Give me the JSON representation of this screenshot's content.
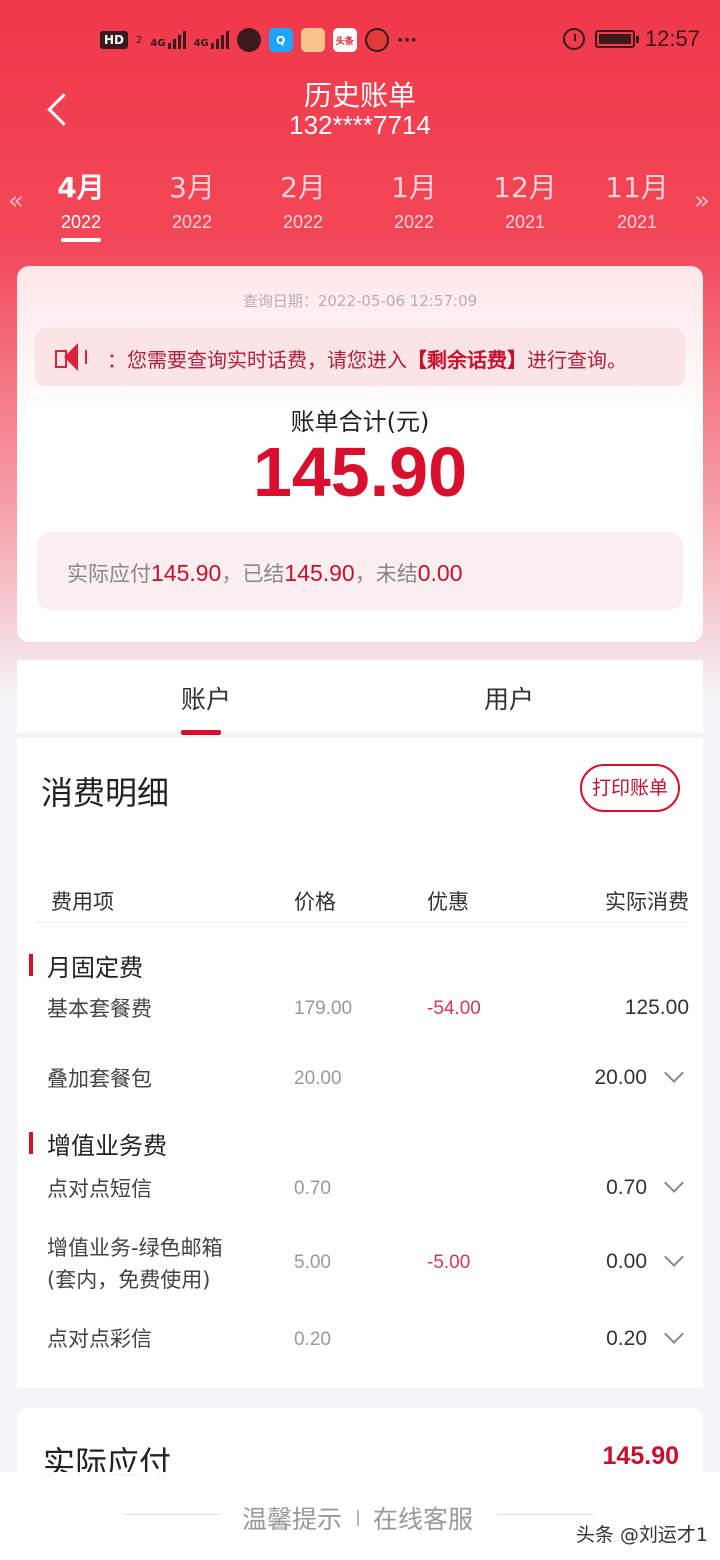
{
  "status_bar": {
    "hd": "HD",
    "sim": "2",
    "signal1": "4G",
    "signal2": "4G",
    "app_icon_3": "头条",
    "more": "···",
    "time": "12:57"
  },
  "header": {
    "title": "历史账单",
    "phone": "132****7714"
  },
  "months": [
    {
      "month": "4月",
      "year": "2022"
    },
    {
      "month": "3月",
      "year": "2022"
    },
    {
      "month": "2月",
      "year": "2022"
    },
    {
      "month": "1月",
      "year": "2022"
    },
    {
      "month": "12月",
      "year": "2021"
    },
    {
      "month": "11月",
      "year": "2021"
    }
  ],
  "nav": {
    "prev": "«",
    "next": "»"
  },
  "summary": {
    "query_date": "查询日期：2022-05-06 12:57:09",
    "notice_pre": "：您需要查询实时话费，请您进入",
    "notice_link": "【剩余话费】",
    "notice_post": "进行查询。",
    "total_label": "账单合计(元)",
    "total_amount": "145.90",
    "due_label": "实际应付",
    "due_value": "145.90",
    "settled_label": "，已结",
    "settled_value": "145.90",
    "unsettled_label": "，未结",
    "unsettled_value": "0.00"
  },
  "tabs": {
    "account": "账户",
    "user": "用户"
  },
  "detail": {
    "title": "消费明细",
    "print_button": "打印账单",
    "headers": {
      "item": "费用项",
      "price": "价格",
      "discount": "优惠",
      "actual": "实际消费"
    },
    "groups": [
      {
        "name": "月固定费",
        "rows": [
          {
            "name": "基本套餐费",
            "price": "179.00",
            "discount": "-54.00",
            "actual": "125.00"
          },
          {
            "name": "叠加套餐包",
            "price": "20.00",
            "discount": "",
            "actual": "20.00"
          }
        ]
      },
      {
        "name": "增值业务费",
        "rows": [
          {
            "name": "点对点短信",
            "price": "0.70",
            "discount": "",
            "actual": "0.70"
          },
          {
            "name": "增值业务-绿色邮箱(套内，免费使用)",
            "name_line1": "增值业务-绿色邮箱",
            "name_line2": "(套内，免费使用)",
            "price": "5.00",
            "discount": "-5.00",
            "actual": "0.00"
          },
          {
            "name": "点对点彩信",
            "price": "0.20",
            "discount": "",
            "actual": "0.20"
          }
        ]
      }
    ]
  },
  "payable": {
    "label": "实际应付",
    "value": "145.90"
  },
  "footer": {
    "tip": "温馨提示",
    "service": "在线客服",
    "watermark": "头条 @刘运才1"
  },
  "colors": {
    "brand_red": "#d8102e",
    "header_red": "#f0394a"
  }
}
